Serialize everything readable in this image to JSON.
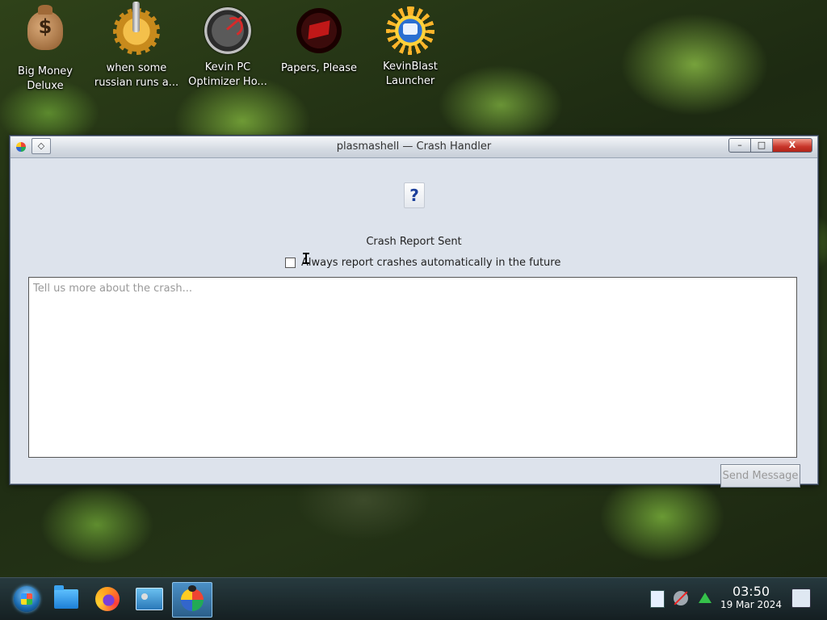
{
  "desktop": {
    "icons": [
      {
        "label_line1": "Big Money",
        "label_line2": "Deluxe",
        "icon": "money-bag-icon"
      },
      {
        "label_line1": "when some",
        "label_line2": "russian runs a...",
        "icon": "gear-icon"
      },
      {
        "label_line1": "Kevin PC",
        "label_line2": "Optimizer Ho...",
        "icon": "gauge-icon"
      },
      {
        "label_line1": "Papers, Please",
        "label_line2": "",
        "icon": "papers-please-icon"
      },
      {
        "label_line1": "KevinBlast",
        "label_line2": "Launcher",
        "icon": "sunburst-icon"
      }
    ]
  },
  "window": {
    "title": "plasmashell — Crash Handler",
    "menu_button_glyph": "◇",
    "minimize_glyph": "–",
    "maximize_glyph": "□",
    "close_glyph": "X",
    "help_icon_glyph": "?",
    "status_text": "Crash Report Sent",
    "auto_report_label": "Always report crashes automatically in the future",
    "auto_report_checked": false,
    "message_placeholder": "Tell us more about the crash...",
    "message_value": "",
    "send_button_label": "Send Message",
    "send_button_enabled": false
  },
  "taskbar": {
    "items": [
      "start-menu-icon",
      "file-manager-icon",
      "firefox-icon",
      "system-monitor-icon",
      "crash-handler-icon"
    ],
    "active_item": "crash-handler-icon",
    "tray": [
      "clipboard-icon",
      "volume-muted-icon",
      "network-icon"
    ],
    "clock_time": "03:50",
    "clock_date": "19 Mar 2024"
  },
  "colors": {
    "window_bg": "#dde3ec",
    "close_button": "#c8352a",
    "taskbar_bg": "#1e2b33",
    "active_task": "#2b5f8a"
  }
}
